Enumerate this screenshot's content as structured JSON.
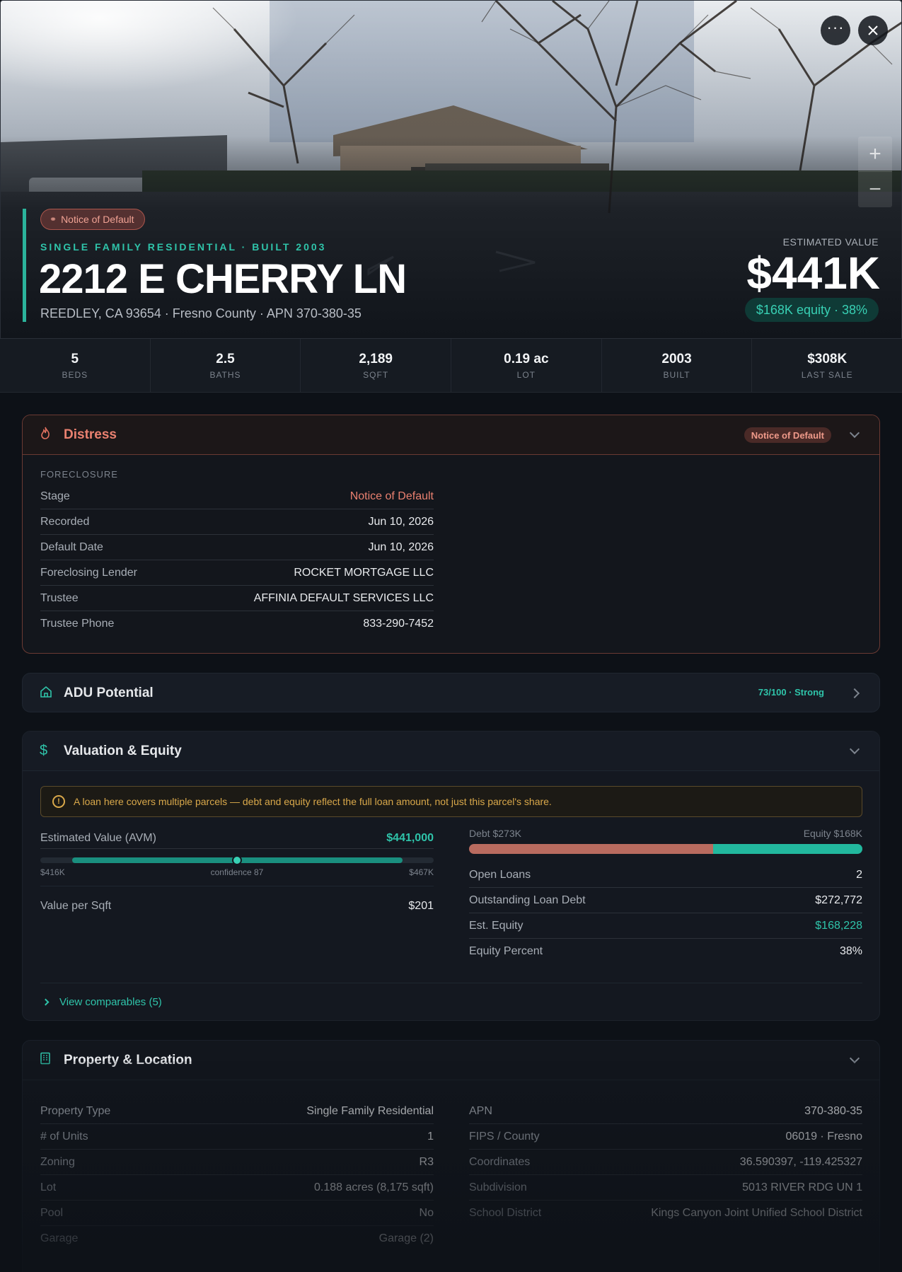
{
  "hero": {
    "status_badge": "Notice of Default",
    "property_type": "SINGLE FAMILY RESIDENTIAL · BUILT 2003",
    "address": "2212 E CHERRY LN",
    "subline": "REEDLEY, CA 93654 · Fresno County · APN 370-380-35",
    "estimated_value_label": "ESTIMATED VALUE",
    "estimated_value": "$441K",
    "equity_summary": "$168K equity · 38%",
    "zoom_in": "+",
    "zoom_out": "−"
  },
  "stats": [
    {
      "value": "5",
      "label": "BEDS"
    },
    {
      "value": "2.5",
      "label": "BATHS"
    },
    {
      "value": "2,189",
      "label": "SQFT"
    },
    {
      "value": "0.19 ac",
      "label": "LOT"
    },
    {
      "value": "2003",
      "label": "BUILT"
    },
    {
      "value": "$308K",
      "label": "LAST SALE"
    }
  ],
  "distress": {
    "title": "Distress",
    "badge": "Notice of Default",
    "section": "FORECLOSURE",
    "rows": [
      {
        "k": "Stage",
        "v": "Notice of Default"
      },
      {
        "k": "Recorded",
        "v": "Jun 10, 2026"
      },
      {
        "k": "Default Date",
        "v": "Jun 10, 2026"
      },
      {
        "k": "Foreclosing Lender",
        "v": "ROCKET MORTGAGE LLC"
      },
      {
        "k": "Trustee",
        "v": "AFFINIA DEFAULT SERVICES LLC"
      },
      {
        "k": "Trustee Phone",
        "v": "833-290-7452"
      }
    ]
  },
  "adu": {
    "title": "ADU Potential",
    "score": "73/100 · Strong"
  },
  "valuation": {
    "title": "Valuation & Equity",
    "warning": "A loan here covers multiple parcels — debt and equity reflect the full loan amount, not just this parcel's share.",
    "avm_label": "Estimated Value (AVM)",
    "avm_value": "$441,000",
    "range_low": "$416K",
    "range_high": "$467K",
    "confidence": "confidence 87",
    "confidence_fraction": 0.5,
    "value_per_sqft_label": "Value per Sqft",
    "value_per_sqft": "$201",
    "debt_label": "Debt $273K",
    "equity_label": "Equity $168K",
    "debt_fraction": 0.62,
    "debt_color": "#b96b5f",
    "equity_color": "#22b89e",
    "rows": [
      {
        "k": "Open Loans",
        "v": "2"
      },
      {
        "k": "Outstanding Loan Debt",
        "v": "$272,772"
      },
      {
        "k": "Est. Equity",
        "v": "$168,228"
      },
      {
        "k": "Equity Percent",
        "v": "38%"
      }
    ],
    "comps_link": "View comparables (5)"
  },
  "location": {
    "title": "Property & Location",
    "left_rows": [
      {
        "k": "Property Type",
        "v": "Single Family Residential"
      },
      {
        "k": "# of Units",
        "v": "1"
      },
      {
        "k": "Zoning",
        "v": "R3"
      },
      {
        "k": "Lot",
        "v": "0.188 acres (8,175 sqft)"
      },
      {
        "k": "Pool",
        "v": "No"
      },
      {
        "k": "Garage",
        "v": "Garage (2)"
      }
    ],
    "right_rows": [
      {
        "k": "APN",
        "v": "370-380-35"
      },
      {
        "k": "FIPS / County",
        "v": "06019 · Fresno"
      },
      {
        "k": "Coordinates",
        "v": "36.590397, -119.425327"
      },
      {
        "k": "Subdivision",
        "v": "5013 RIVER RDG UN 1"
      },
      {
        "k": "School District",
        "v": "Kings Canyon Joint Unified School District"
      }
    ]
  },
  "colors": {
    "accent": "#2fc4aa",
    "danger": "#ea8170",
    "background": "#0d1117"
  }
}
